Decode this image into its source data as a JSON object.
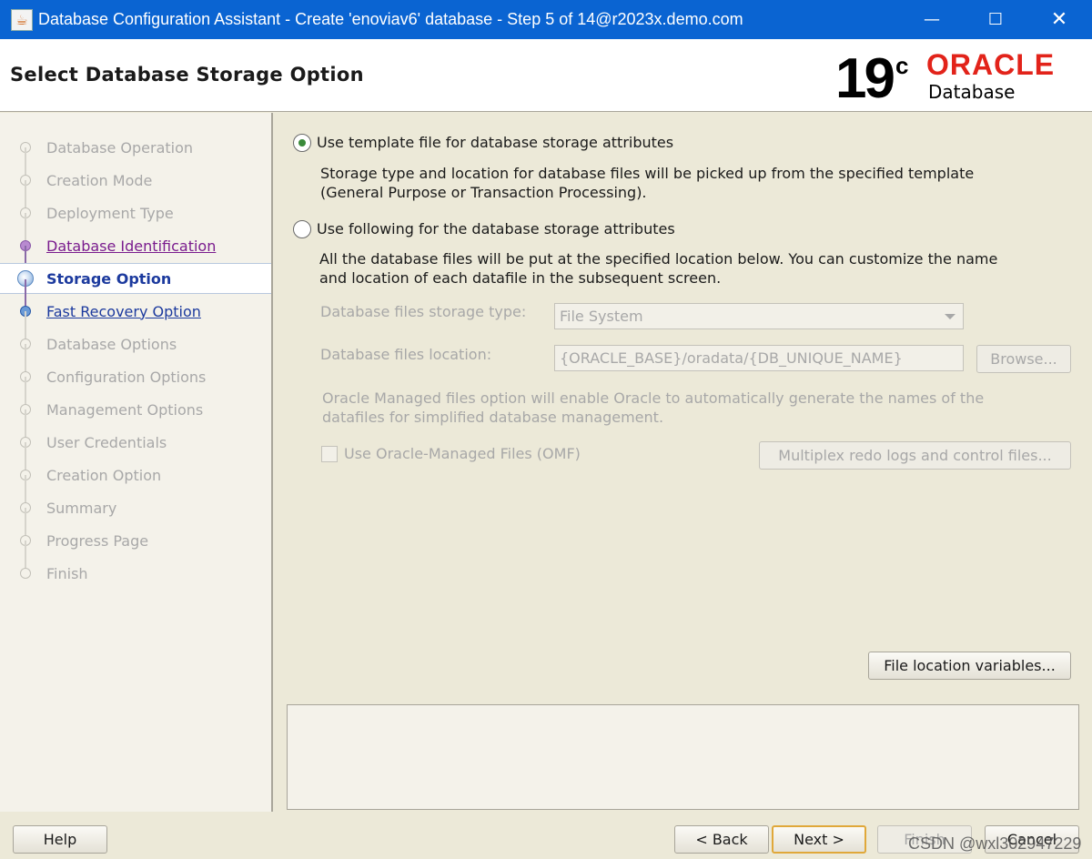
{
  "window": {
    "title": "Database Configuration Assistant - Create 'enoviav6' database - Step 5 of 14@r2023x.demo.com",
    "minimize_glyph": "—",
    "maximize_glyph": "☐",
    "close_glyph": "✕"
  },
  "header": {
    "title": "Select Database Storage Option",
    "logo": {
      "version": "19",
      "version_suffix": "c",
      "brand": "ORACLE",
      "product": "Database"
    }
  },
  "steps": [
    {
      "label": "Database Operation",
      "state": "disabled"
    },
    {
      "label": "Creation Mode",
      "state": "disabled"
    },
    {
      "label": "Deployment Type",
      "state": "disabled"
    },
    {
      "label": "Database Identification",
      "state": "visited"
    },
    {
      "label": "Storage Option",
      "state": "current"
    },
    {
      "label": "Fast Recovery Option",
      "state": "link"
    },
    {
      "label": "Database Options",
      "state": "disabled"
    },
    {
      "label": "Configuration Options",
      "state": "disabled"
    },
    {
      "label": "Management Options",
      "state": "disabled"
    },
    {
      "label": "User Credentials",
      "state": "disabled"
    },
    {
      "label": "Creation Option",
      "state": "disabled"
    },
    {
      "label": "Summary",
      "state": "disabled"
    },
    {
      "label": "Progress Page",
      "state": "disabled"
    },
    {
      "label": "Finish",
      "state": "disabled"
    }
  ],
  "content": {
    "option_template": {
      "label": "Use template file for database storage attributes",
      "selected": true,
      "description_line1": "Storage type and location for database files will be picked up from the specified template",
      "description_line2": "(General Purpose or Transaction Processing)."
    },
    "option_following": {
      "label": "Use following for the database storage attributes",
      "selected": false,
      "description_line1": "All the database files will be put at the specified location below. You can customize the name",
      "description_line2": "and location of each datafile in the subsequent screen."
    },
    "storage_type": {
      "label": "Database files storage type:",
      "value": "File System"
    },
    "files_location": {
      "label": "Database files location:",
      "value": "{ORACLE_BASE}/oradata/{DB_UNIQUE_NAME}",
      "browse_label": "Browse..."
    },
    "omf_note_line1": "Oracle Managed files option will enable Oracle to automatically generate the names of the",
    "omf_note_line2": "datafiles for simplified database management.",
    "omf_checkbox": {
      "label": "Use Oracle-Managed Files (OMF)",
      "checked": false
    },
    "multiplex_label": "Multiplex redo logs and control files...",
    "file_location_vars_label": "File location variables..."
  },
  "footer": {
    "help_label": "Help",
    "back_label": "< Back",
    "next_label": "Next >",
    "finish_label": "Finish",
    "cancel_label": "Cancel"
  },
  "watermark": "CSDN @wxl302947229",
  "colors": {
    "titlebar": "#0a64d2",
    "oracle_red": "#e2231a",
    "current_step": "#1c3a9e",
    "visited_step": "#7a1c8e"
  }
}
